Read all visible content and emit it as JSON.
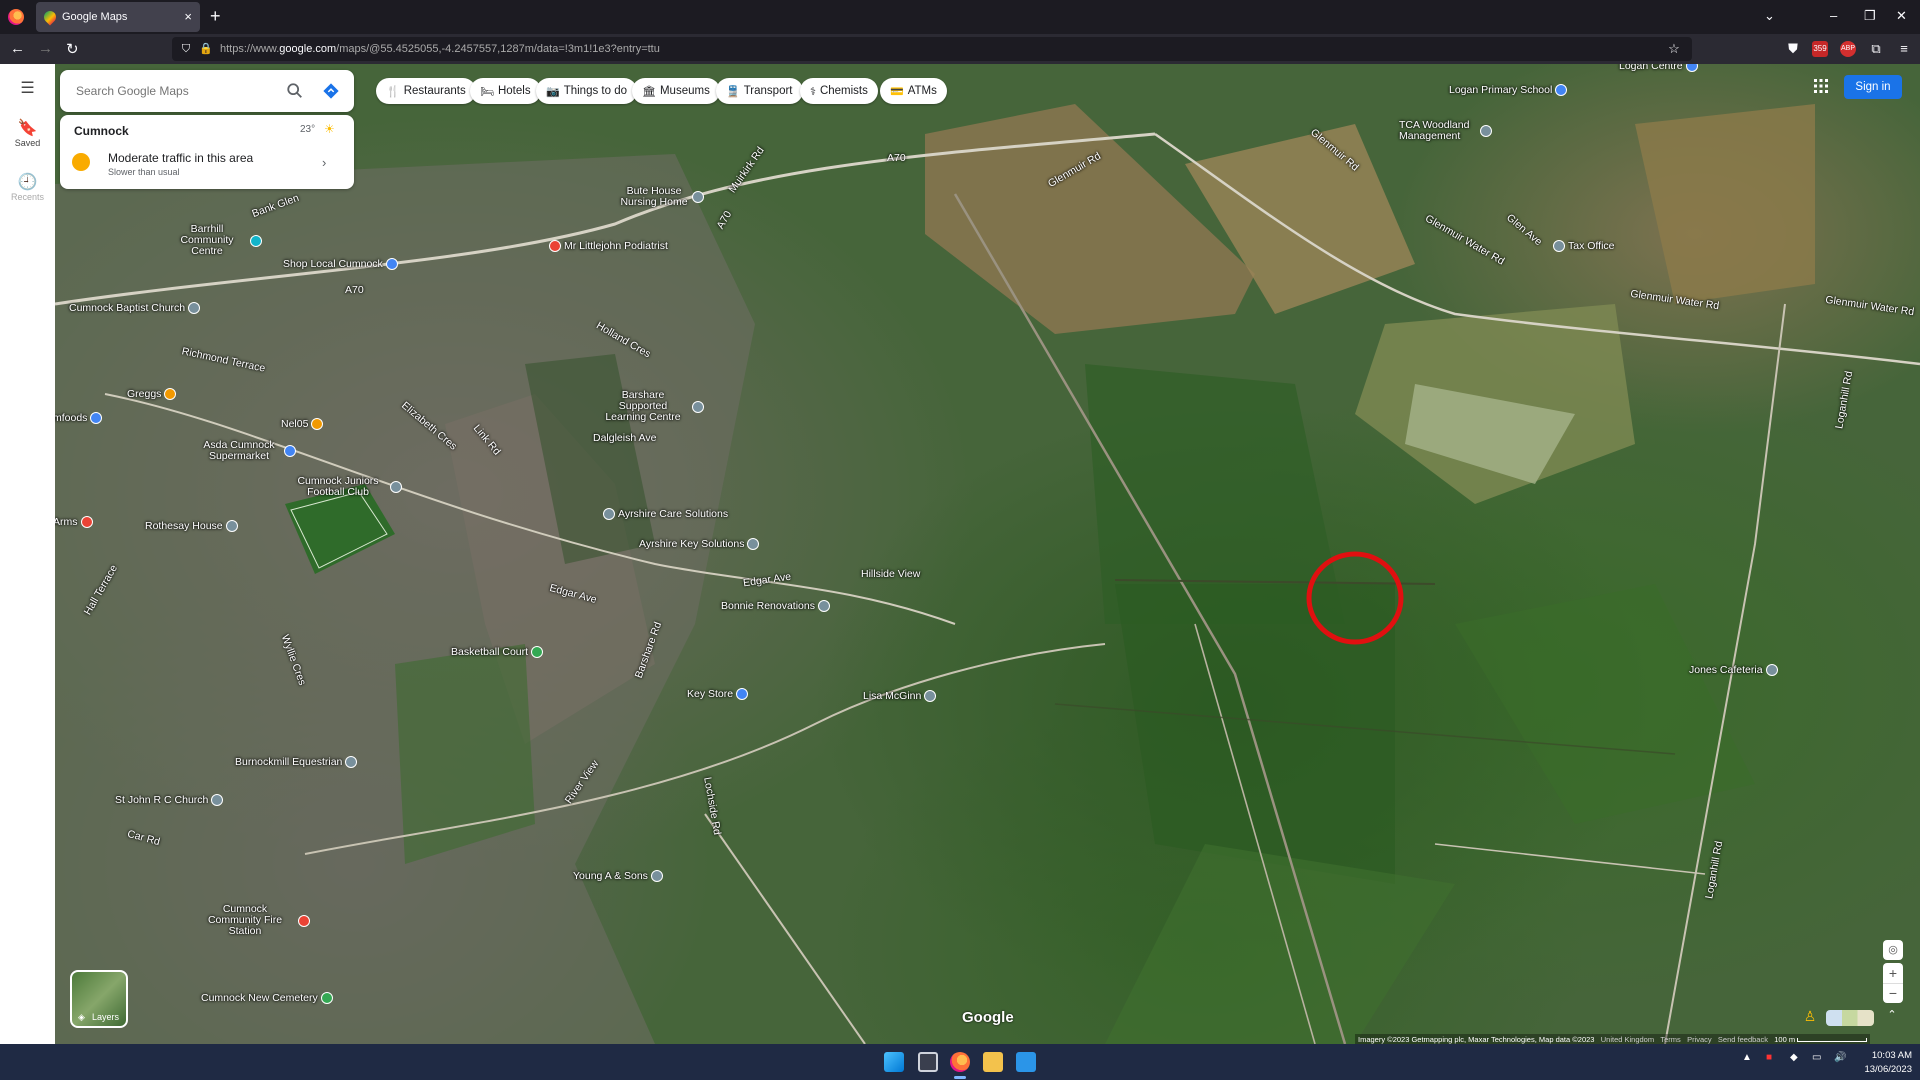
{
  "browser": {
    "tab_title": "Google Maps",
    "url_prefix": "https://www.",
    "url_domain": "google.com",
    "url_rest": "/maps/@55.4525055,-4.2457557,1287m/data=!3m1!1e3?entry=ttu",
    "tab_close": "×",
    "new_tab": "+",
    "badge_count": "359"
  },
  "sidebar": {
    "menu_icon": "hamburger-menu-icon",
    "items": [
      {
        "label": "Saved",
        "icon": "bookmark-icon"
      },
      {
        "label": "Recents",
        "icon": "history-icon"
      }
    ]
  },
  "search": {
    "placeholder": "Search Google Maps"
  },
  "traffic_card": {
    "place": "Cumnock",
    "temperature": "23°",
    "headline": "Moderate traffic in this area",
    "subtext": "Slower than usual"
  },
  "chips": [
    {
      "label": "Restaurants",
      "icon": "🍴"
    },
    {
      "label": "Hotels",
      "icon": "🛏"
    },
    {
      "label": "Things to do",
      "icon": "📷"
    },
    {
      "label": "Museums",
      "icon": "🏛"
    },
    {
      "label": "Transport",
      "icon": "🚆"
    },
    {
      "label": "Chemists",
      "icon": "⚕"
    },
    {
      "label": "ATMs",
      "icon": "💳"
    }
  ],
  "sign_in": "Sign in",
  "map_labels": {
    "roads": [
      "A70",
      "A70",
      "A70",
      "Muirkirk Rd",
      "Glenmuir Rd",
      "Glenmuir Water Rd",
      "Glenmuir Water Rd",
      "Glenmuir Water Rd",
      "Glen Ave",
      "Glenmuir Rd",
      "Loganhill Rd",
      "Loganhill Rd",
      "Hillside View",
      "Edgar Ave",
      "Edgar Ave",
      "Dalgleish Ave",
      "Holland Cres",
      "Link Rd",
      "Elizabeth Cres",
      "Richmond Terrace",
      "Bank Glen",
      "Hall Terrace",
      "River View",
      "Car Rd",
      "Wyllie Cres",
      "Barshare Rd",
      "Lochside Rd"
    ],
    "pois": [
      {
        "name": "Logan Centre",
        "color": "#4285f4"
      },
      {
        "name": "Logan Primary School",
        "color": "#4285f4"
      },
      {
        "name": "TCA Woodland Management",
        "color": "#4285f4"
      },
      {
        "name": "Tax Office",
        "color": "#4285f4"
      },
      {
        "name": "Bute House Nursing Home",
        "color": "#4285f4"
      },
      {
        "name": "Mr Littlejohn Podiatrist",
        "color": "#ea4335"
      },
      {
        "name": "Barrhill Community Centre",
        "color": "#12b5cb"
      },
      {
        "name": "Shop Local Cumnock",
        "color": "#4285f4"
      },
      {
        "name": "Cumnock Baptist Church",
        "color": "#78909c"
      },
      {
        "name": "Barshare Supported Learning Centre",
        "color": "#78909c"
      },
      {
        "name": "Greggs",
        "color": "#f29900"
      },
      {
        "name": "Nel05",
        "color": "#f29900"
      },
      {
        "name": "Asda Cumnock Supermarket",
        "color": "#4285f4"
      },
      {
        "name": "Cumnock Juniors Football Club",
        "color": "#78909c"
      },
      {
        "name": "Ayrshire Care Solutions",
        "color": "#78909c"
      },
      {
        "name": "Ayrshire Key Solutions",
        "color": "#78909c"
      },
      {
        "name": "Rothesay House",
        "color": "#78909c"
      },
      {
        "name": "Bonnie Renovations",
        "color": "#78909c"
      },
      {
        "name": "Basketball Court",
        "color": "#34a853"
      },
      {
        "name": "Key Store",
        "color": "#4285f4"
      },
      {
        "name": "Lisa McGinn",
        "color": "#78909c"
      },
      {
        "name": "Jones Cafeteria",
        "color": "#78909c"
      },
      {
        "name": "Burnockmill Equestrian",
        "color": "#78909c"
      },
      {
        "name": "St John R C Church",
        "color": "#78909c"
      },
      {
        "name": "Young A & Sons",
        "color": "#78909c"
      },
      {
        "name": "Cumnock Community Fire Station",
        "color": "#ea4335"
      },
      {
        "name": "Cumnock New Cemetery",
        "color": "#34a853"
      },
      {
        "name": "mfoods",
        "color": "#4285f4"
      },
      {
        "name": "Arms",
        "color": "#ea4335"
      }
    ]
  },
  "layers_label": "Layers",
  "google_watermark": "Google",
  "footer": {
    "imagery": "Imagery ©2023 Getmapping plc, Maxar Technologies, Map data ©2023",
    "region": "United Kingdom",
    "terms": "Terms",
    "privacy": "Privacy",
    "feedback": "Send feedback",
    "scale": "100 m"
  },
  "taskbar": {
    "time": "10:03 AM",
    "date": "13/06/2023"
  },
  "colors": {
    "accent": "#1a73e8",
    "highlight_circle": "#e01010"
  }
}
